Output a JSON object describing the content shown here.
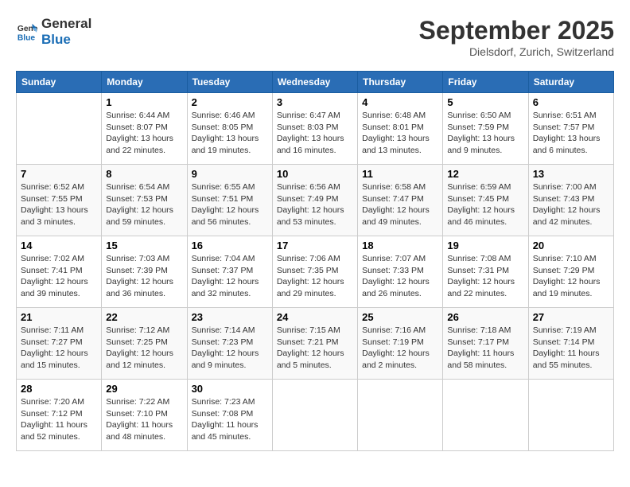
{
  "header": {
    "logo_line1": "General",
    "logo_line2": "Blue",
    "month_title": "September 2025",
    "location": "Dielsdorf, Zurich, Switzerland"
  },
  "columns": [
    "Sunday",
    "Monday",
    "Tuesday",
    "Wednesday",
    "Thursday",
    "Friday",
    "Saturday"
  ],
  "weeks": [
    [
      {
        "day": "",
        "info": ""
      },
      {
        "day": "1",
        "info": "Sunrise: 6:44 AM\nSunset: 8:07 PM\nDaylight: 13 hours\nand 22 minutes."
      },
      {
        "day": "2",
        "info": "Sunrise: 6:46 AM\nSunset: 8:05 PM\nDaylight: 13 hours\nand 19 minutes."
      },
      {
        "day": "3",
        "info": "Sunrise: 6:47 AM\nSunset: 8:03 PM\nDaylight: 13 hours\nand 16 minutes."
      },
      {
        "day": "4",
        "info": "Sunrise: 6:48 AM\nSunset: 8:01 PM\nDaylight: 13 hours\nand 13 minutes."
      },
      {
        "day": "5",
        "info": "Sunrise: 6:50 AM\nSunset: 7:59 PM\nDaylight: 13 hours\nand 9 minutes."
      },
      {
        "day": "6",
        "info": "Sunrise: 6:51 AM\nSunset: 7:57 PM\nDaylight: 13 hours\nand 6 minutes."
      }
    ],
    [
      {
        "day": "7",
        "info": "Sunrise: 6:52 AM\nSunset: 7:55 PM\nDaylight: 13 hours\nand 3 minutes."
      },
      {
        "day": "8",
        "info": "Sunrise: 6:54 AM\nSunset: 7:53 PM\nDaylight: 12 hours\nand 59 minutes."
      },
      {
        "day": "9",
        "info": "Sunrise: 6:55 AM\nSunset: 7:51 PM\nDaylight: 12 hours\nand 56 minutes."
      },
      {
        "day": "10",
        "info": "Sunrise: 6:56 AM\nSunset: 7:49 PM\nDaylight: 12 hours\nand 53 minutes."
      },
      {
        "day": "11",
        "info": "Sunrise: 6:58 AM\nSunset: 7:47 PM\nDaylight: 12 hours\nand 49 minutes."
      },
      {
        "day": "12",
        "info": "Sunrise: 6:59 AM\nSunset: 7:45 PM\nDaylight: 12 hours\nand 46 minutes."
      },
      {
        "day": "13",
        "info": "Sunrise: 7:00 AM\nSunset: 7:43 PM\nDaylight: 12 hours\nand 42 minutes."
      }
    ],
    [
      {
        "day": "14",
        "info": "Sunrise: 7:02 AM\nSunset: 7:41 PM\nDaylight: 12 hours\nand 39 minutes."
      },
      {
        "day": "15",
        "info": "Sunrise: 7:03 AM\nSunset: 7:39 PM\nDaylight: 12 hours\nand 36 minutes."
      },
      {
        "day": "16",
        "info": "Sunrise: 7:04 AM\nSunset: 7:37 PM\nDaylight: 12 hours\nand 32 minutes."
      },
      {
        "day": "17",
        "info": "Sunrise: 7:06 AM\nSunset: 7:35 PM\nDaylight: 12 hours\nand 29 minutes."
      },
      {
        "day": "18",
        "info": "Sunrise: 7:07 AM\nSunset: 7:33 PM\nDaylight: 12 hours\nand 26 minutes."
      },
      {
        "day": "19",
        "info": "Sunrise: 7:08 AM\nSunset: 7:31 PM\nDaylight: 12 hours\nand 22 minutes."
      },
      {
        "day": "20",
        "info": "Sunrise: 7:10 AM\nSunset: 7:29 PM\nDaylight: 12 hours\nand 19 minutes."
      }
    ],
    [
      {
        "day": "21",
        "info": "Sunrise: 7:11 AM\nSunset: 7:27 PM\nDaylight: 12 hours\nand 15 minutes."
      },
      {
        "day": "22",
        "info": "Sunrise: 7:12 AM\nSunset: 7:25 PM\nDaylight: 12 hours\nand 12 minutes."
      },
      {
        "day": "23",
        "info": "Sunrise: 7:14 AM\nSunset: 7:23 PM\nDaylight: 12 hours\nand 9 minutes."
      },
      {
        "day": "24",
        "info": "Sunrise: 7:15 AM\nSunset: 7:21 PM\nDaylight: 12 hours\nand 5 minutes."
      },
      {
        "day": "25",
        "info": "Sunrise: 7:16 AM\nSunset: 7:19 PM\nDaylight: 12 hours\nand 2 minutes."
      },
      {
        "day": "26",
        "info": "Sunrise: 7:18 AM\nSunset: 7:17 PM\nDaylight: 11 hours\nand 58 minutes."
      },
      {
        "day": "27",
        "info": "Sunrise: 7:19 AM\nSunset: 7:14 PM\nDaylight: 11 hours\nand 55 minutes."
      }
    ],
    [
      {
        "day": "28",
        "info": "Sunrise: 7:20 AM\nSunset: 7:12 PM\nDaylight: 11 hours\nand 52 minutes."
      },
      {
        "day": "29",
        "info": "Sunrise: 7:22 AM\nSunset: 7:10 PM\nDaylight: 11 hours\nand 48 minutes."
      },
      {
        "day": "30",
        "info": "Sunrise: 7:23 AM\nSunset: 7:08 PM\nDaylight: 11 hours\nand 45 minutes."
      },
      {
        "day": "",
        "info": ""
      },
      {
        "day": "",
        "info": ""
      },
      {
        "day": "",
        "info": ""
      },
      {
        "day": "",
        "info": ""
      }
    ]
  ]
}
